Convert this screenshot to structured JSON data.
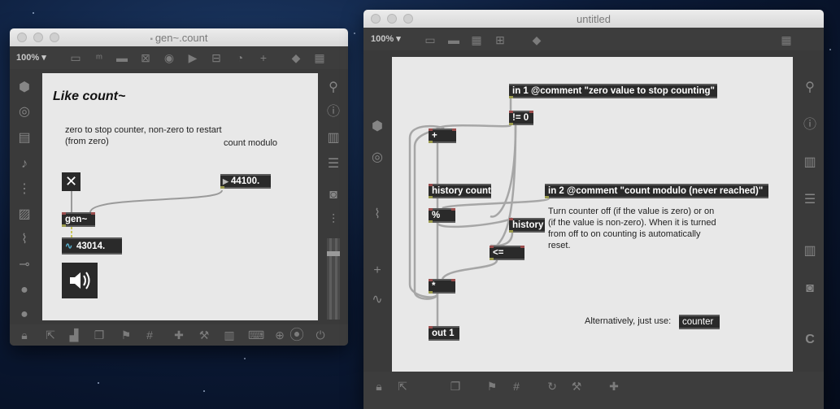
{
  "left_window": {
    "title": "gen~.count",
    "zoom": "100%",
    "heading": "Like count~",
    "comment_zero": "zero to stop counter, non-zero to restart (from zero)",
    "comment_modulo": "count modulo",
    "number_value": "44100.",
    "gen_object": "gen~",
    "signal_value": "43014."
  },
  "right_window": {
    "title": "untitled",
    "zoom": "100%",
    "objects": {
      "in1": "in 1 @comment \"zero value to stop counting\"",
      "neq": "!= 0",
      "plus": "+",
      "history_count": "history count",
      "in2": "in 2 @comment \"count modulo (never reached)\"",
      "mod": "%",
      "history": "history",
      "lte": "<=",
      "mult": "*",
      "out1": "out 1",
      "counter": "counter"
    },
    "comment_toggle": "Turn counter off (if the value is zero) or on (if the value is non-zero).  When it is turned from off to on counting is automatically reset.",
    "comment_alt": "Alternatively, just use:"
  }
}
